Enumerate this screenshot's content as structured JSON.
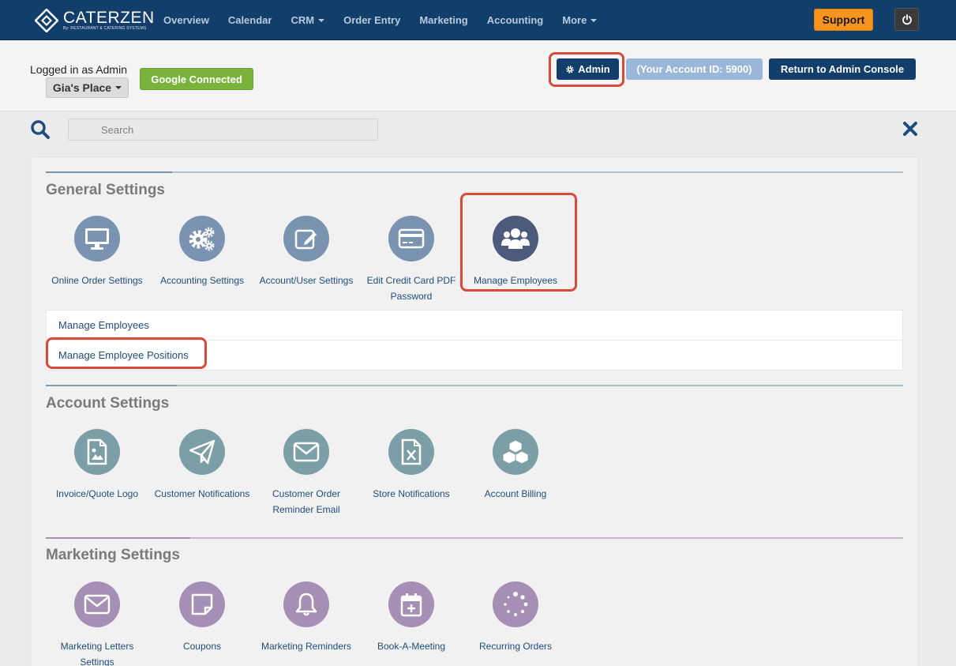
{
  "brand": {
    "name": "CATERZEN",
    "tagline": "By: RESTAURANT & CATERING SYSTEMS"
  },
  "nav": {
    "items": [
      {
        "label": "Overview",
        "dropdown": false
      },
      {
        "label": "Calendar",
        "dropdown": false
      },
      {
        "label": "CRM",
        "dropdown": true
      },
      {
        "label": "Order Entry",
        "dropdown": false
      },
      {
        "label": "Marketing",
        "dropdown": false
      },
      {
        "label": "Accounting",
        "dropdown": false
      },
      {
        "label": "More",
        "dropdown": true
      }
    ],
    "support_label": "Support",
    "power_icon": "power-icon"
  },
  "header": {
    "logged_in_text": "Logged in as Admin",
    "place_label": "Gia's Place",
    "google_label": "Google Connected",
    "admin_label": "Admin",
    "account_label": "(Your Account ID: 5900)",
    "return_label": "Return to Admin Console"
  },
  "search": {
    "placeholder": "Search"
  },
  "sections": {
    "general": {
      "title": "General Settings",
      "tiles": [
        {
          "label": "Online Order Settings",
          "icon": "monitor-icon"
        },
        {
          "label": "Accounting Settings",
          "icon": "gears-icon"
        },
        {
          "label": "Account/User Settings",
          "icon": "edit-icon"
        },
        {
          "label": "Edit Credit Card PDF Password",
          "icon": "credit-card-icon"
        },
        {
          "label": "Manage Employees",
          "icon": "users-icon"
        }
      ],
      "submenu": [
        "Manage Employees",
        "Manage Employee Positions"
      ]
    },
    "account": {
      "title": "Account Settings",
      "tiles": [
        {
          "label": "Invoice/Quote Logo",
          "icon": "image-file-icon"
        },
        {
          "label": "Customer Notifications",
          "icon": "paper-plane-icon"
        },
        {
          "label": "Customer Order Reminder Email",
          "icon": "envelope-icon"
        },
        {
          "label": "Store Notifications",
          "icon": "excel-file-icon"
        },
        {
          "label": "Account Billing",
          "icon": "cubes-icon"
        }
      ]
    },
    "marketing": {
      "title": "Marketing Settings",
      "tiles": [
        {
          "label": "Marketing Letters Settings",
          "icon": "envelope-icon"
        },
        {
          "label": "Coupons",
          "icon": "sticky-note-icon"
        },
        {
          "label": "Marketing Reminders",
          "icon": "bell-icon"
        },
        {
          "label": "Book-A-Meeting",
          "icon": "calendar-plus-icon"
        },
        {
          "label": "Recurring Orders",
          "icon": "spinner-icon"
        }
      ]
    }
  },
  "colors": {
    "navbar": "#123e6b",
    "support": "#f7941d",
    "google": "#7ab33c",
    "highlight": "#d94a38",
    "general_accent": "#7a93b0",
    "account_accent": "#7c9ea6",
    "marketing_accent": "#a68fb4"
  }
}
